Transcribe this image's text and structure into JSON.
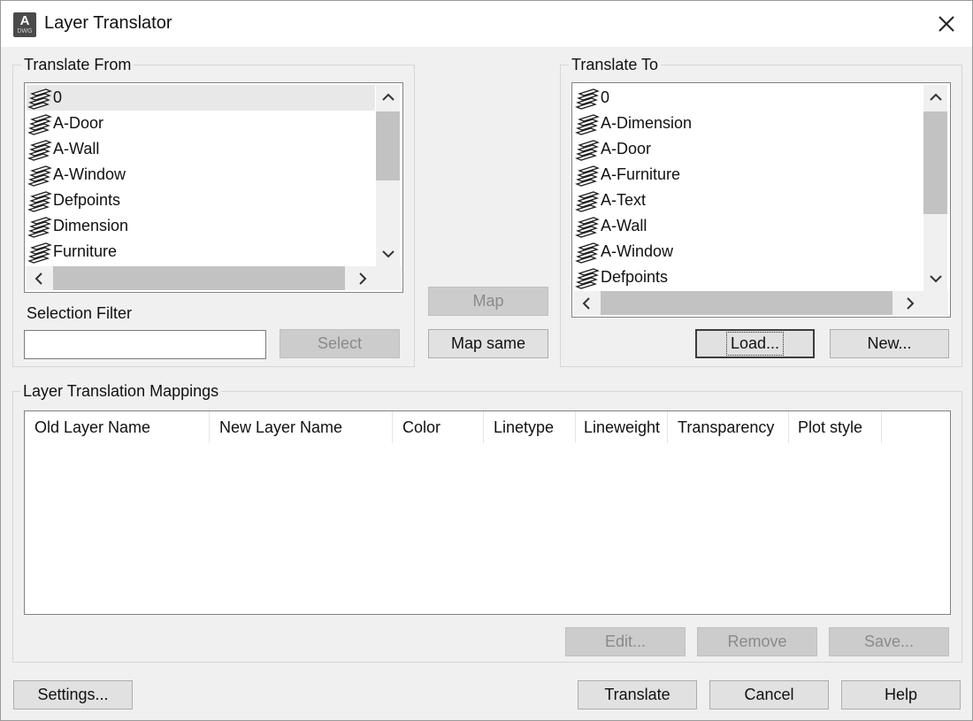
{
  "window": {
    "title": "Layer Translator",
    "app_icon_letter": "A",
    "app_icon_caption": "DWG"
  },
  "translate_from": {
    "legend": "Translate From",
    "layers": [
      "0",
      "A-Door",
      "A-Wall",
      "A-Window",
      "Defpoints",
      "Dimension",
      "Furniture"
    ],
    "selected_index": 0,
    "selection_filter": {
      "label": "Selection Filter",
      "value": "",
      "select_label": "Select"
    }
  },
  "center_buttons": {
    "map_label": "Map",
    "map_same_label": "Map same"
  },
  "translate_to": {
    "legend": "Translate To",
    "layers": [
      "0",
      "A-Dimension",
      "A-Door",
      "A-Furniture",
      "A-Text",
      "A-Wall",
      "A-Window",
      "Defpoints"
    ],
    "load_label": "Load...",
    "new_label": "New..."
  },
  "mappings": {
    "legend": "Layer Translation Mappings",
    "columns": [
      "Old Layer Name",
      "New Layer Name",
      "Color",
      "Linetype",
      "Lineweight",
      "Transparency",
      "Plot style"
    ],
    "rows": [],
    "edit_label": "Edit...",
    "remove_label": "Remove",
    "save_label": "Save..."
  },
  "footer": {
    "settings_label": "Settings...",
    "translate_label": "Translate",
    "cancel_label": "Cancel",
    "help_label": "Help"
  },
  "icons": {
    "layer_item": "layer-stack-icon",
    "close": "close-icon",
    "scroll_up": "chevron-up-icon",
    "scroll_down": "chevron-down-icon",
    "scroll_left": "chevron-left-icon",
    "scroll_right": "chevron-right-icon"
  }
}
